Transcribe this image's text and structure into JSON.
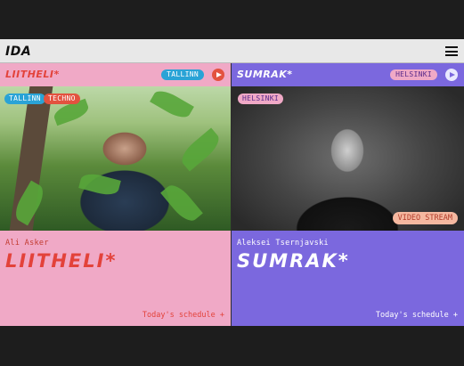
{
  "header": {
    "logo": "IDA",
    "menu_icon": "hamburger-icon"
  },
  "left": {
    "station": "LIITHELI*",
    "city_pill": "TALLINN",
    "tags": [
      "TALLINN",
      "TECHNO"
    ],
    "artist": "Ali Asker",
    "show_title": "LIITHELI*",
    "schedule_link": "Today's schedule +"
  },
  "right": {
    "station": "SUMRAK*",
    "city_pill": "HELSINKI",
    "tags": [
      "HELSINKI"
    ],
    "stream_badge": "VIDEO STREAM",
    "artist": "Aleksei Tsernjavski",
    "show_title": "SUMRAK*",
    "schedule_link": "Today's schedule +"
  },
  "colors": {
    "pink": "#f0a9c6",
    "purple": "#7b68de",
    "red": "#e3423a",
    "blue": "#2aa3d6"
  }
}
